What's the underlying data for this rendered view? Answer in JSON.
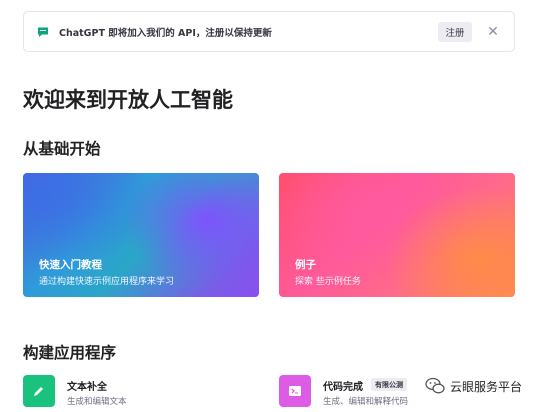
{
  "banner": {
    "message": "ChatGPT 即将加入我们的 API，注册以保持更新",
    "register_label": "注册",
    "close_glyph": "✕",
    "icon": "chat-icon"
  },
  "page_title": "欢迎来到开放人工智能",
  "sections": {
    "start": "从基础开始",
    "build": "构建应用程序"
  },
  "cards": [
    {
      "title": "快速入门教程",
      "desc": "通过构建快速示例应用程序来学习"
    },
    {
      "title": "例子",
      "desc": "探索  些示例任务"
    }
  ],
  "apps": [
    {
      "title": "文本补全",
      "desc": "生成和编辑文本",
      "icon": "pencil-icon",
      "color": "#19c37d"
    },
    {
      "title": "代码完成",
      "desc": "生成、编辑和解释代码",
      "badge": "有限公测",
      "icon": "terminal-icon",
      "color": "#dd5ce5"
    }
  ],
  "watermark": {
    "text": "云眼服务平台",
    "icon": "wechat-icon"
  }
}
